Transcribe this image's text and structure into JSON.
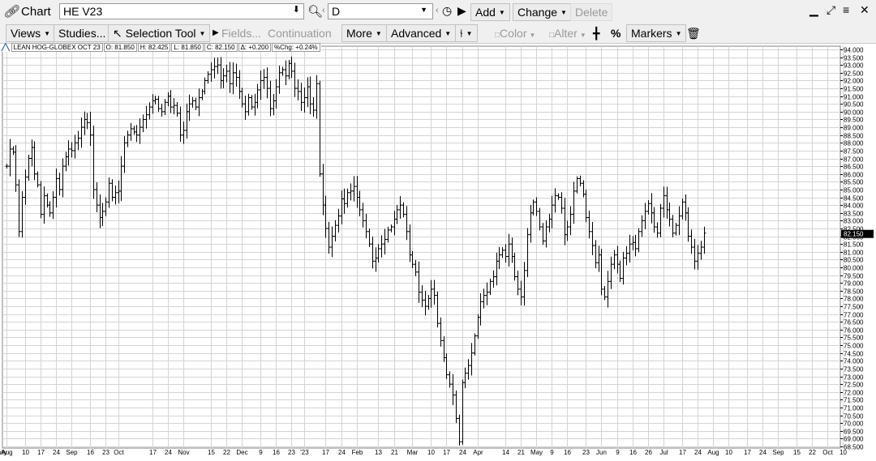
{
  "app": {
    "title": "Chart"
  },
  "symbol": {
    "value": "HE V23"
  },
  "interval": {
    "value": "D"
  },
  "header_buttons": {
    "add": "Add",
    "change": "Change",
    "delete": "Delete"
  },
  "toolbar": {
    "views": "Views",
    "studies": "Studies...",
    "selection_tool": "Selection Tool",
    "fields": "Fields...",
    "continuation": "Continuation",
    "more": "More",
    "advanced": "Advanced",
    "color": "Color",
    "alter": "Alter",
    "percent": "%",
    "markers": "Markers"
  },
  "info": {
    "name": "LEAN HOG-GLOBEX OCT 23",
    "open": "O: 81.850",
    "high": "H: 82.425",
    "low": "L: 81.850",
    "close": "C: 82.150",
    "change": "Δ: +0.200",
    "pct_change": "%Chg: +0.24%"
  },
  "chart_data": {
    "type": "ohlc",
    "ylim": [
      68.5,
      94.0
    ],
    "y_tick_step": 0.5,
    "last_price": 82.15,
    "last_price_label": "82.150",
    "x_labels": [
      "Aug",
      "10",
      "17",
      "24",
      "Sep",
      "16",
      "23",
      "Oct",
      "17",
      "24",
      "Nov",
      "15",
      "22",
      "Dec",
      "9",
      "16",
      "23",
      "'23",
      "17",
      "24",
      "Feb",
      "13",
      "21",
      "Mar",
      "10",
      "17",
      "24",
      "Apr",
      "14",
      "21",
      "May",
      "9",
      "16",
      "23",
      "Jun",
      "9",
      "16",
      "26",
      "Jul",
      "17",
      "24",
      "Aug",
      "10",
      "17",
      "24",
      "Sep",
      "15",
      "22",
      "Oct",
      "10",
      "Daily"
    ],
    "x_label_bars": [
      0,
      6,
      11,
      16,
      21,
      27,
      32,
      36,
      47,
      52,
      57,
      66,
      71,
      76,
      82,
      87,
      92,
      96,
      103,
      108,
      113,
      120,
      125,
      131,
      137,
      142,
      147,
      152,
      161,
      166,
      171,
      176,
      181,
      187,
      192,
      197,
      202,
      207,
      212,
      218,
      223,
      228,
      233,
      239,
      244,
      249,
      255,
      260,
      265,
      270
    ],
    "closes": [
      86.5,
      87.6,
      87.4,
      85.3,
      82.3,
      84.5,
      85.8,
      87.0,
      87.7,
      86.0,
      85.3,
      83.4,
      84.6,
      84.0,
      83.5,
      84.5,
      85.7,
      85.0,
      86.5,
      87.1,
      87.6,
      87.5,
      88.0,
      88.3,
      89.0,
      89.5,
      89.3,
      88.5,
      85.0,
      84.0,
      83.2,
      83.6,
      84.2,
      85.4,
      84.5,
      84.8,
      84.9,
      86.5,
      88.0,
      88.5,
      88.9,
      88.7,
      88.5,
      89.0,
      89.5,
      89.8,
      90.3,
      90.7,
      90.8,
      90.2,
      90.0,
      90.6,
      91.0,
      90.3,
      90.4,
      89.9,
      88.5,
      88.8,
      90.0,
      90.5,
      90.7,
      90.3,
      90.9,
      91.3,
      92.0,
      92.4,
      92.7,
      92.9,
      93.0,
      92.0,
      92.3,
      92.6,
      91.8,
      92.5,
      92.2,
      91.3,
      90.5,
      90.0,
      90.9,
      90.3,
      90.6,
      91.4,
      92.0,
      92.2,
      91.5,
      90.2,
      90.7,
      91.6,
      92.5,
      92.7,
      92.3,
      93.1,
      92.6,
      91.5,
      91.3,
      90.6,
      90.9,
      91.6,
      90.5,
      90.1,
      91.8,
      86.0,
      84.0,
      82.5,
      81.3,
      82.0,
      82.7,
      83.3,
      84.4,
      84.1,
      84.8,
      84.9,
      85.2,
      84.5,
      83.7,
      83.0,
      82.3,
      81.5,
      80.4,
      80.6,
      81.2,
      81.5,
      81.8,
      82.4,
      82.6,
      83.1,
      83.7,
      84.0,
      83.4,
      82.3,
      80.8,
      80.2,
      79.7,
      78.4,
      77.9,
      77.5,
      78.0,
      78.6,
      78.2,
      76.4,
      75.3,
      74.2,
      73.1,
      72.5,
      71.8,
      70.3,
      68.8,
      72.6,
      73.2,
      73.7,
      74.5,
      75.6,
      76.8,
      77.8,
      78.2,
      78.4,
      79.1,
      79.4,
      80.4,
      80.8,
      81.1,
      80.7,
      81.5,
      80.7,
      79.4,
      78.6,
      78.1,
      79.8,
      82.1,
      83.5,
      84.2,
      83.6,
      82.6,
      81.7,
      82.6,
      83.1,
      84.0,
      84.6,
      84.5,
      83.8,
      82.1,
      82.6,
      83.4,
      84.9,
      85.7,
      85.4,
      84.7,
      83.2,
      82.3,
      81.4,
      80.3,
      80.8,
      78.6,
      78.1,
      79.1,
      80.2,
      80.8,
      80.2,
      79.3,
      80.6,
      80.9,
      81.5,
      81.6,
      81.2,
      82.3,
      83.0,
      83.6,
      84.1,
      83.5,
      82.6,
      82.2,
      83.8,
      84.6,
      83.7,
      83.1,
      82.2,
      82.7,
      83.3,
      84.2,
      83.5,
      82.0,
      81.3,
      80.4,
      80.9,
      81.3,
      82.2
    ]
  }
}
